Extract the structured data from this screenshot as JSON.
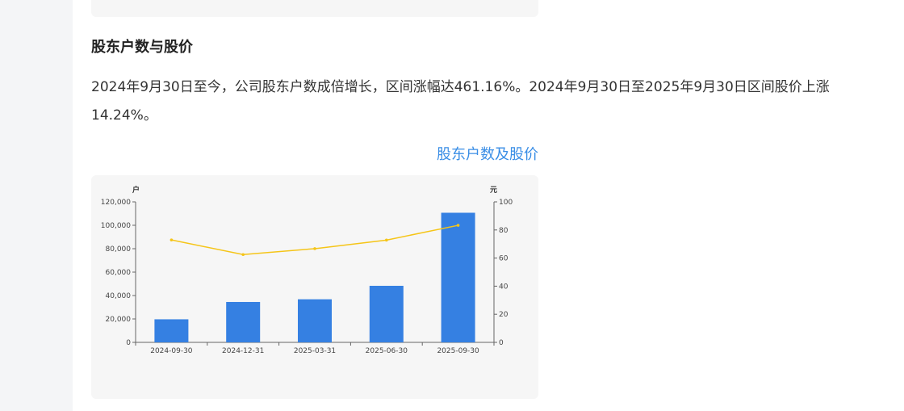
{
  "section": {
    "title": "股东户数与股价",
    "paragraph": "2024年9月30日至今，公司股东户数成倍增长，区间涨幅达461.16%。2024年9月30日至2025年9月30日区间股价上涨14.24%。"
  },
  "chart_link": "股东户数及股价",
  "chart_data": {
    "type": "bar",
    "categories": [
      "2024-09-30",
      "2024-12-31",
      "2025-03-31",
      "2025-06-30",
      "2025-09-30"
    ],
    "series": [
      {
        "kind": "bar",
        "axis": "left",
        "values": [
          19700,
          34500,
          36800,
          48300,
          110700
        ],
        "color": "#3580e2"
      },
      {
        "kind": "line",
        "axis": "right",
        "values": [
          72.9,
          62.5,
          66.7,
          72.8,
          83.3
        ],
        "color": "#f5c518"
      }
    ],
    "y_left": {
      "unit": "户",
      "min": 0,
      "max": 120000,
      "ticks": [
        "0",
        "20,000",
        "40,000",
        "60,000",
        "80,000",
        "100,000",
        "120,000"
      ]
    },
    "y_right": {
      "unit": "元",
      "min": 0,
      "max": 100,
      "ticks": [
        "0",
        "20",
        "40",
        "60",
        "80",
        "100"
      ]
    },
    "grid": false
  }
}
